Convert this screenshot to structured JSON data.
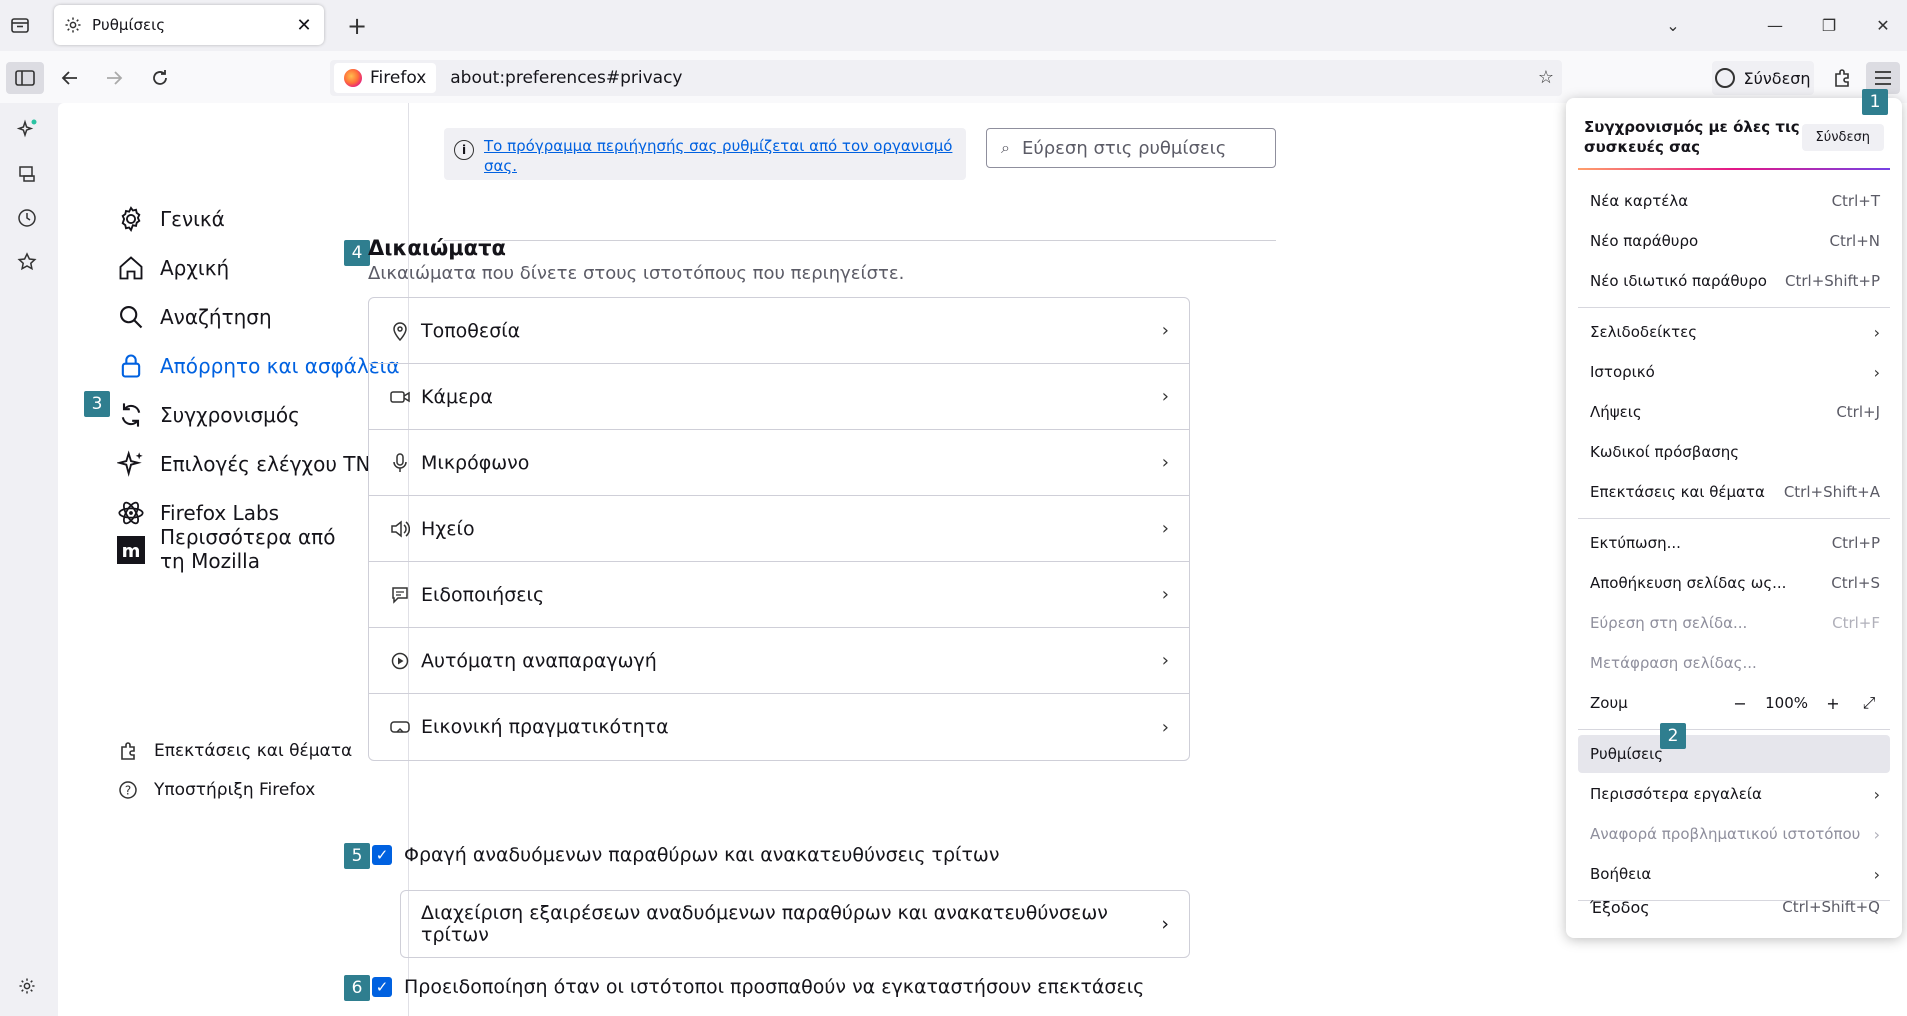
{
  "tab": {
    "title": "Ρυθμίσεις",
    "close": "✕"
  },
  "newtab": "+",
  "window": {
    "list_all": "⌄",
    "minimize": "—",
    "restore": "❐",
    "close": "✕"
  },
  "urlbar": {
    "identity": "Firefox",
    "url": "about:preferences#privacy"
  },
  "toolbar": {
    "signin_label": "Σύνδεση"
  },
  "categories": [
    {
      "label": "Γενικά"
    },
    {
      "label": "Αρχική"
    },
    {
      "label": "Αναζήτηση"
    },
    {
      "label": "Απόρρητο και ασφάλεια"
    },
    {
      "label": "Συγχρονισμός"
    },
    {
      "label": "Επιλογές ελέγχου ΤΝ"
    },
    {
      "label": "Firefox Labs"
    },
    {
      "label": "Περισσότερα από τη Mozilla"
    }
  ],
  "footer": {
    "addons": "Επεκτάσεις και θέματα",
    "support": "Υποστήριξη Firefox"
  },
  "policy_notice": "Το πρόγραμμα περιήγησής σας ρυθμίζεται από τον οργανισμό σας.",
  "search": {
    "placeholder": "Εύρεση στις ρυθμίσεις"
  },
  "permissions": {
    "title": "Δικαιώματα",
    "subtitle": "Δικαιώματα που δίνετε στους ιστοτόπους που περιηγείστε.",
    "items": [
      {
        "label": "Τοποθεσία"
      },
      {
        "label": "Κάμερα"
      },
      {
        "label": "Μικρόφωνο"
      },
      {
        "label": "Ηχείο"
      },
      {
        "label": "Ειδοποιήσεις"
      },
      {
        "label": "Αυτόματη αναπαραγωγή"
      },
      {
        "label": "Εικονική πραγματικότητα"
      }
    ]
  },
  "popups": {
    "checkbox_label": "Φραγή αναδυόμενων παραθύρων και ανακατευθύνσεις τρίτων",
    "exceptions_label": "Διαχείριση εξαιρέσεων αναδυόμενων παραθύρων και ανακατευθύνσεων τρίτων"
  },
  "addons_warn": {
    "checkbox_label": "Προειδοποίηση όταν οι ιστότοποι προσπαθούν να εγκαταστήσουν επεκτάσεις"
  },
  "badges": {
    "b1": "1",
    "b2": "2",
    "b3": "3",
    "b4": "4",
    "b5": "5",
    "b6": "6"
  },
  "app_menu": {
    "sync_text": "Συγχρονισμός με όλες τις συσκευές σας",
    "sync_button": "Σύνδεση",
    "new_tab": {
      "label": "Νέα καρτέλα",
      "key": "Ctrl+T"
    },
    "new_window": {
      "label": "Νέο παράθυρο",
      "key": "Ctrl+N"
    },
    "new_private": {
      "label": "Νέο ιδιωτικό παράθυρο",
      "key": "Ctrl+Shift+P"
    },
    "bookmarks": {
      "label": "Σελιδοδείκτες"
    },
    "history": {
      "label": "Ιστορικό"
    },
    "downloads": {
      "label": "Λήψεις",
      "key": "Ctrl+J"
    },
    "passwords": {
      "label": "Κωδικοί πρόσβασης"
    },
    "addons": {
      "label": "Επεκτάσεις και θέματα",
      "key": "Ctrl+Shift+A"
    },
    "print": {
      "label": "Εκτύπωση...",
      "key": "Ctrl+P"
    },
    "save_page": {
      "label": "Αποθήκευση σελίδας ως...",
      "key": "Ctrl+S"
    },
    "find": {
      "label": "Εύρεση στη σελίδα...",
      "key": "Ctrl+F"
    },
    "translate": {
      "label": "Μετάφραση σελίδας..."
    },
    "zoom": {
      "label": "Ζουμ",
      "value": "100%"
    },
    "settings": {
      "label": "Ρυθμίσεις"
    },
    "more_tools": {
      "label": "Περισσότερα εργαλεία"
    },
    "report_site": {
      "label": "Αναφορά προβληματικού ιστοτόπου"
    },
    "help": {
      "label": "Βοήθεια"
    },
    "exit": {
      "label": "Έξοδος",
      "key": "Ctrl+Shift+Q"
    }
  }
}
